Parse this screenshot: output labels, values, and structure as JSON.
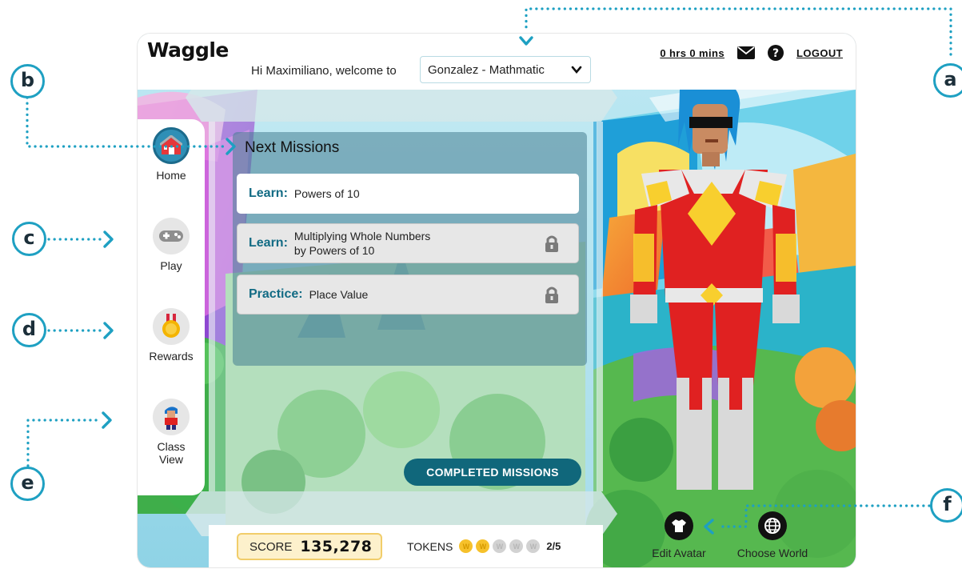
{
  "app": {
    "logo": "Waggle"
  },
  "header": {
    "welcome": "Hi Maximiliano, welcome to",
    "class_selected": "Gonzalez - Mathmatic",
    "time": "0 hrs 0 mins",
    "logout": "LOGOUT"
  },
  "nav": {
    "items": [
      {
        "label": "Home",
        "icon": "home-icon",
        "active": true
      },
      {
        "label": "Play",
        "icon": "gamepad-icon",
        "active": false
      },
      {
        "label": "Rewards",
        "icon": "medal-icon",
        "active": false
      },
      {
        "label_line1": "Class",
        "label_line2": "View",
        "icon": "avatar-icon",
        "active": false
      }
    ]
  },
  "missions": {
    "title": "Next Missions",
    "list": [
      {
        "kind": "Learn:",
        "title": "Powers of 10",
        "locked": false
      },
      {
        "kind": "Learn:",
        "title_line1": "Multiplying Whole Numbers",
        "title_line2": "by Powers of 10",
        "locked": true
      },
      {
        "kind": "Practice:",
        "title": "Place Value",
        "locked": true
      }
    ],
    "completed_button": "COMPLETED MISSIONS"
  },
  "score": {
    "label": "SCORE",
    "value": "135,278"
  },
  "tokens": {
    "label": "TOKENS",
    "earned": 2,
    "total": 5,
    "count_text": "2/5",
    "token_letter": "W"
  },
  "avatar": {
    "edit_label": "Edit Avatar",
    "world_label": "Choose World"
  },
  "callouts": [
    "a",
    "b",
    "c",
    "d",
    "e",
    "f"
  ],
  "colors": {
    "accent": "#1ea0c2",
    "brand_teal": "#10677b",
    "mission_kind": "#126b84",
    "token_gold": "#f6c12b",
    "score_bg": "#fdf1cc"
  }
}
